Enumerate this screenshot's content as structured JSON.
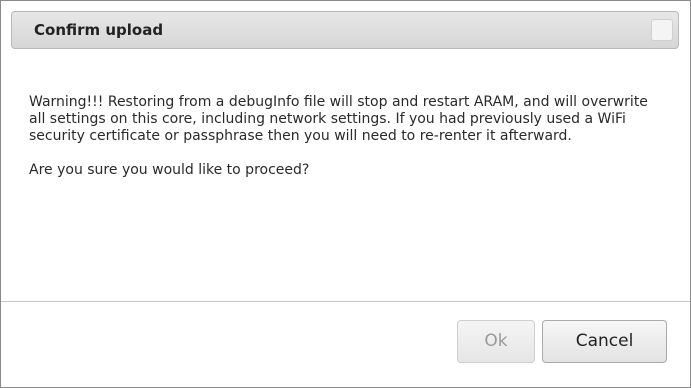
{
  "dialog": {
    "title": "Confirm upload",
    "warning_text": "Warning!!! Restoring from a debugInfo file will stop and restart ARAM, and will overwrite all settings on this core, including network settings. If you had previously used a WiFi security certificate or passphrase then you will need to re-renter it afterward.",
    "question_text": "Are you sure you would like to proceed?",
    "close_icon": "close-icon",
    "buttons": {
      "ok_label": "Ok",
      "ok_state": "disabled",
      "cancel_label": "Cancel"
    }
  }
}
